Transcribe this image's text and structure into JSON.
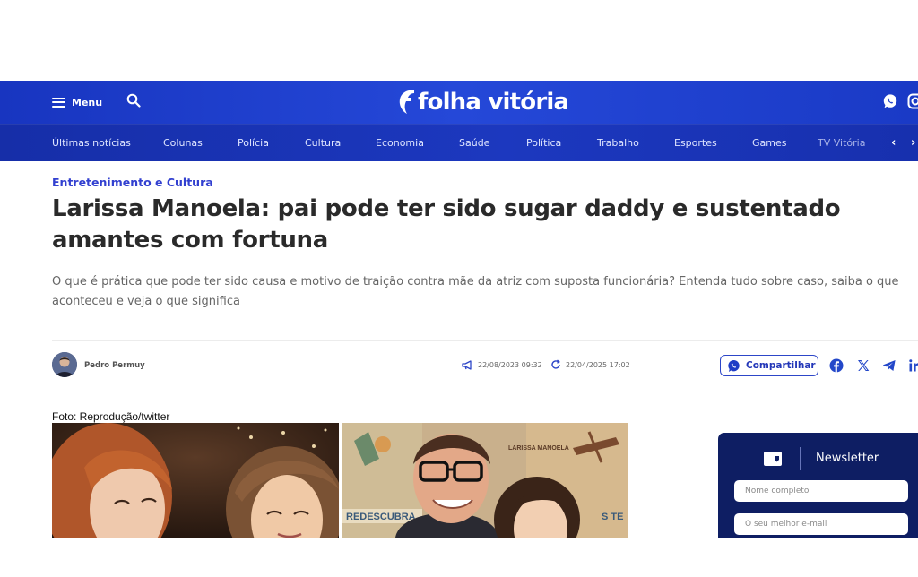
{
  "header": {
    "menu_label": "Menu",
    "logo_text": "folha vitória",
    "brand_color": "#1e3fc8"
  },
  "nav": {
    "items": [
      "Últimas notícias",
      "Colunas",
      "Polícia",
      "Cultura",
      "Economia",
      "Saúde",
      "Política",
      "Trabalho",
      "Esportes",
      "Games",
      "TV Vitória"
    ],
    "prev_arrow": "‹",
    "next_arrow": "›"
  },
  "article": {
    "category": "Entretenimento e Cultura",
    "title": "Larissa Manoela: pai pode ter sido sugar daddy e sustentado amantes com fortuna",
    "lead": "O que é prática que pode ter sido causa e motivo de traição contra mãe da atriz com suposta funcionária? Entenda tudo sobre caso, saiba o que aconteceu e veja o que significa",
    "author": "Pedro Permuy",
    "published": "22/08/2023 09:32",
    "updated": "22/04/2025 17:02",
    "share_label": "Compartilhar",
    "photo_caption": "Foto: Reprodução/twitter",
    "photo_poster_text": "LARISSA MANOELA",
    "photo_banner_left": "REDESCUBRA",
    "photo_banner_right": "S TE"
  },
  "newsletter": {
    "title": "Newsletter",
    "name_placeholder": "Nome completo",
    "email_placeholder": "O seu melhor e-mail"
  },
  "icons": [
    "hamburger-icon",
    "search-icon",
    "whatsapp-icon",
    "instagram-icon",
    "megaphone-icon",
    "refresh-icon",
    "facebook-icon",
    "x-icon",
    "telegram-icon",
    "linkedin-icon",
    "mail-icon"
  ]
}
